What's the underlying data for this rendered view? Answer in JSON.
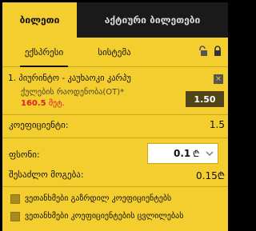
{
  "tabs": {
    "active": "ბილეთი",
    "inactive": "აქტიური ბილეთები"
  },
  "subtabs": {
    "express": "ექსპრესი",
    "system": "სისტემა"
  },
  "bet": {
    "title": "1. პიურინტო - კაუხაოკი კარპუ",
    "market": "ქულების რაოდენობა(OT)*",
    "stake_amount": "160.5",
    "stake_unit": " მეტ.",
    "close_label": "×",
    "odds": "1.50"
  },
  "summary": {
    "coef_label": "კოეფიციენტი:",
    "coef_value": "1.5",
    "stake_label": "ფსონი:",
    "stake_value": "0.1",
    "currency": "₾",
    "win_label": "შესაძლო მოგება:",
    "win_value": "0.15₾"
  },
  "options": [
    "ვეთანხმები გაზრდილ კოეფიციენტებს",
    "ვეთანხმები კოეფიციენტების ცვლილებას"
  ],
  "icons": {
    "lock_open": "lock-open-icon",
    "lock_closed": "lock-icon",
    "close": "close-icon",
    "chevron": "chevron-down-icon"
  },
  "colors": {
    "panel": "#f4ce2e",
    "dark_tab": "#1a1a1a",
    "odds_bg": "#504316",
    "stake_red": "#d6222a"
  }
}
